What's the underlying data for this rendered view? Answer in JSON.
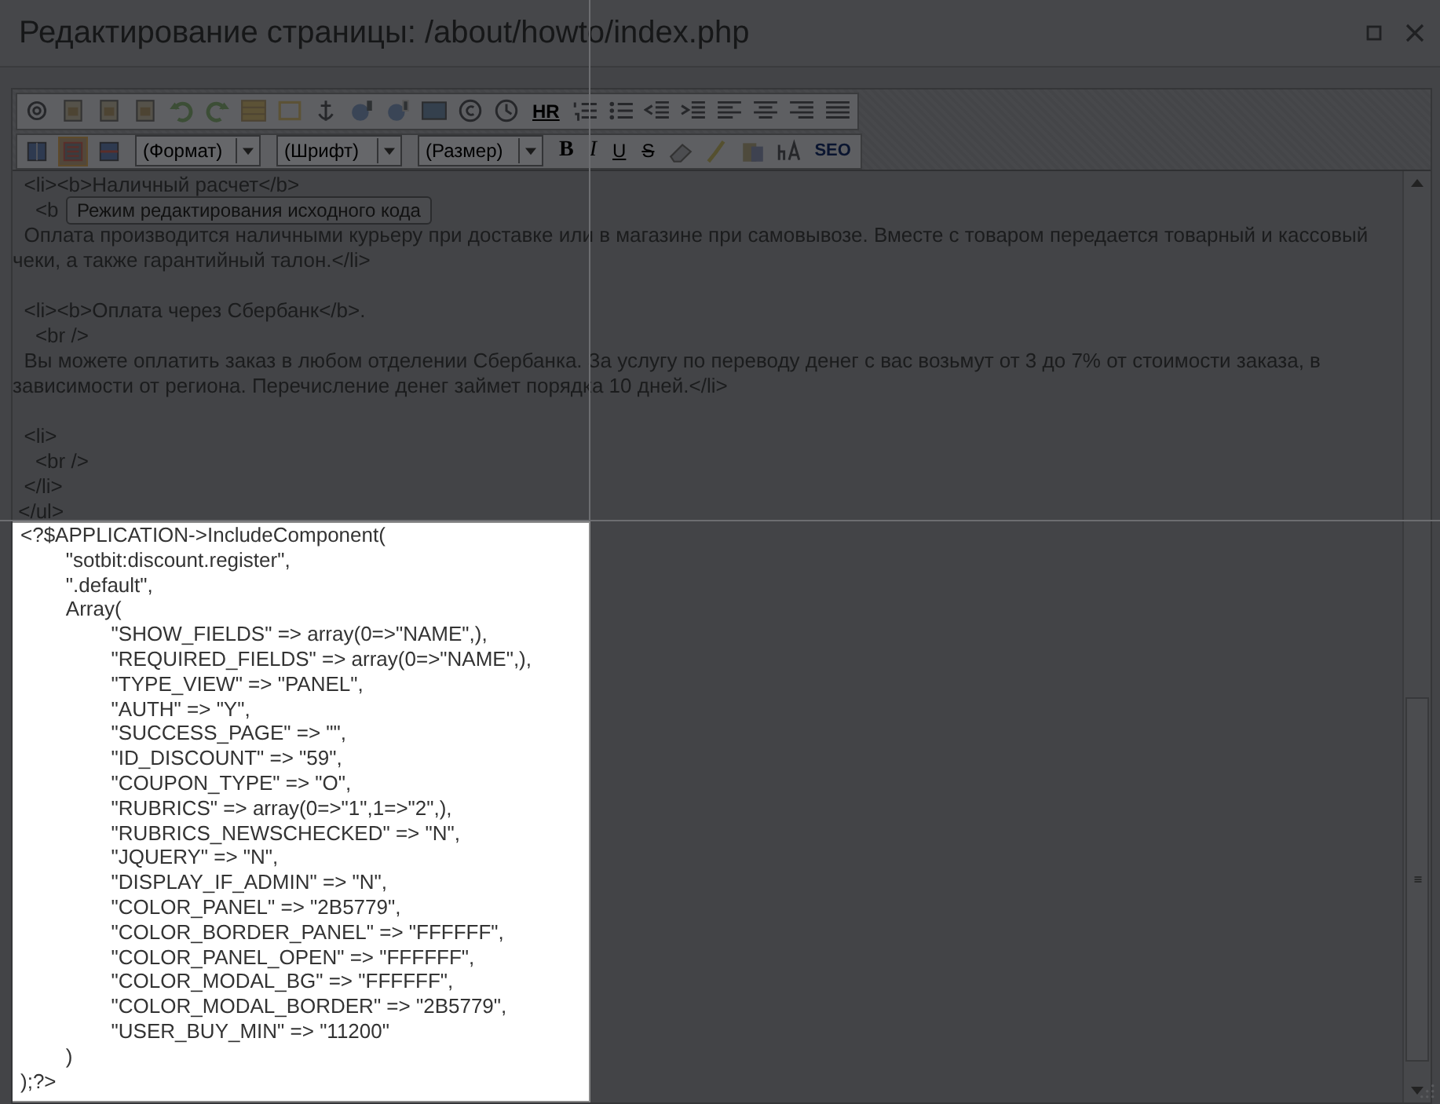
{
  "window": {
    "title": "Редактирование страницы: /about/howto/index.php"
  },
  "toolbar": {
    "row_1": [
      {
        "kind": "gear"
      },
      {
        "kind": "page"
      },
      {
        "kind": "page"
      },
      {
        "kind": "page"
      },
      {
        "kind": "undo"
      },
      {
        "kind": "redo"
      },
      {
        "kind": "table"
      },
      {
        "kind": "frame"
      },
      {
        "kind": "anchor"
      },
      {
        "kind": "link"
      },
      {
        "kind": "unlink"
      },
      {
        "kind": "image"
      },
      {
        "kind": "copyright"
      },
      {
        "kind": "clock"
      },
      {
        "kind": "hr",
        "label": "HR"
      },
      {
        "kind": "ol"
      },
      {
        "kind": "ul"
      },
      {
        "kind": "outdent"
      },
      {
        "kind": "indent"
      },
      {
        "kind": "align-left"
      },
      {
        "kind": "align-center"
      },
      {
        "kind": "align-right"
      },
      {
        "kind": "justify"
      }
    ],
    "row_2": [
      {
        "kind": "split-view",
        "selected": false
      },
      {
        "kind": "source-view",
        "selected": true
      },
      {
        "kind": "visual-view",
        "selected": false
      },
      {
        "kind": "dropdown",
        "value": "(Формат)"
      },
      {
        "kind": "dropdown",
        "value": "(Шрифт)"
      },
      {
        "kind": "dropdown",
        "value": "(Размер)"
      },
      {
        "kind": "bold",
        "label": "B"
      },
      {
        "kind": "italic",
        "label": "I"
      },
      {
        "kind": "underline",
        "label": "U"
      },
      {
        "kind": "strike",
        "label": "S"
      },
      {
        "kind": "eraser"
      },
      {
        "kind": "brush"
      },
      {
        "kind": "paste"
      },
      {
        "kind": "typograph"
      },
      {
        "kind": "seo",
        "label": "SEO"
      }
    ]
  },
  "tooltip": "Режим редактирования исходного кода",
  "source_blocks": [
    [
      "  <li><b>Наличный расчет</b>",
      "    <b",
      "  Оплата производится наличными курьеру при доставке или в магазине при самовывозе. Вместе с товаром передается товарный и кассовый чеки, а также гарантийный талон.</li>"
    ],
    [
      "  <li><b>Оплата через Сбербанк</b>.",
      "    <br />",
      "  Вы можете оплатить заказ в любом отделении Сбербанка. За услугу по переводу денег с вас возьмут от 3 до 7% от стоимости заказа, в зависимости от региона. Перечисление денег займет порядка 10 дней.</li>"
    ],
    [
      "  <li>",
      "    <br />",
      "  </li>",
      " </ul>"
    ]
  ],
  "highlighted_code": [
    "<?$APPLICATION->IncludeComponent(",
    "\t\"sotbit:discount.register\",",
    "\t\".default\",",
    "\tArray(",
    "\t\t\"SHOW_FIELDS\" => array(0=>\"NAME\",),",
    "\t\t\"REQUIRED_FIELDS\" => array(0=>\"NAME\",),",
    "\t\t\"TYPE_VIEW\" => \"PANEL\",",
    "\t\t\"AUTH\" => \"Y\",",
    "\t\t\"SUCCESS_PAGE\" => \"\",",
    "\t\t\"ID_DISCOUNT\" => \"59\",",
    "\t\t\"COUPON_TYPE\" => \"O\",",
    "\t\t\"RUBRICS\" => array(0=>\"1\",1=>\"2\",),",
    "\t\t\"RUBRICS_NEWSCHECKED\" => \"N\",",
    "\t\t\"JQUERY\" => \"N\",",
    "\t\t\"DISPLAY_IF_ADMIN\" => \"N\",",
    "\t\t\"COLOR_PANEL\" => \"2B5779\",",
    "\t\t\"COLOR_BORDER_PANEL\" => \"FFFFFF\",",
    "\t\t\"COLOR_PANEL_OPEN\" => \"FFFFFF\",",
    "\t\t\"COLOR_MODAL_BG\" => \"FFFFFF\",",
    "\t\t\"COLOR_MODAL_BORDER\" => \"2B5779\",",
    "\t\t\"USER_BUY_MIN\" => \"11200\"",
    "\t)",
    ");?>"
  ]
}
